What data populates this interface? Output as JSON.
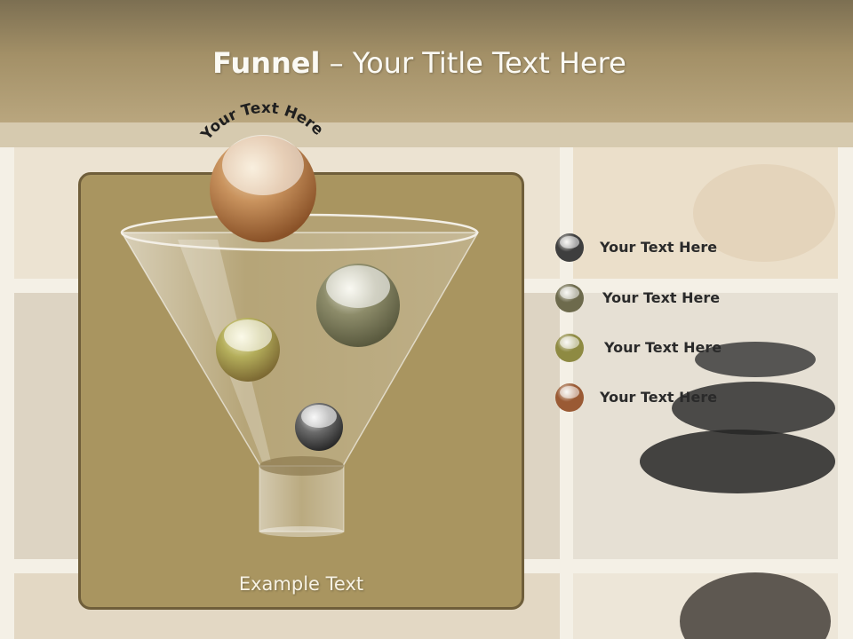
{
  "slide": {
    "title_bold": "Funnel",
    "title_rest": " – Your Title Text Here",
    "top_arc_text": "Your Text Here",
    "example_text": "Example Text"
  },
  "legend": [
    {
      "label": "Your  Text Here",
      "color": "#3e3e3e",
      "icon": "gray-ball-icon"
    },
    {
      "label": "Your  Text Here",
      "color": "#6d6a4c",
      "icon": "olive-ball-icon"
    },
    {
      "label": "Your  Text Here",
      "color": "#8e8a42",
      "icon": "yellow-green-ball-icon"
    },
    {
      "label": "Your  Text Here",
      "color": "#9a5a34",
      "icon": "brown-ball-icon"
    }
  ],
  "colors": {
    "header": "#a39067",
    "panel": "#a99560",
    "panel_border": "#6f5e3a"
  }
}
